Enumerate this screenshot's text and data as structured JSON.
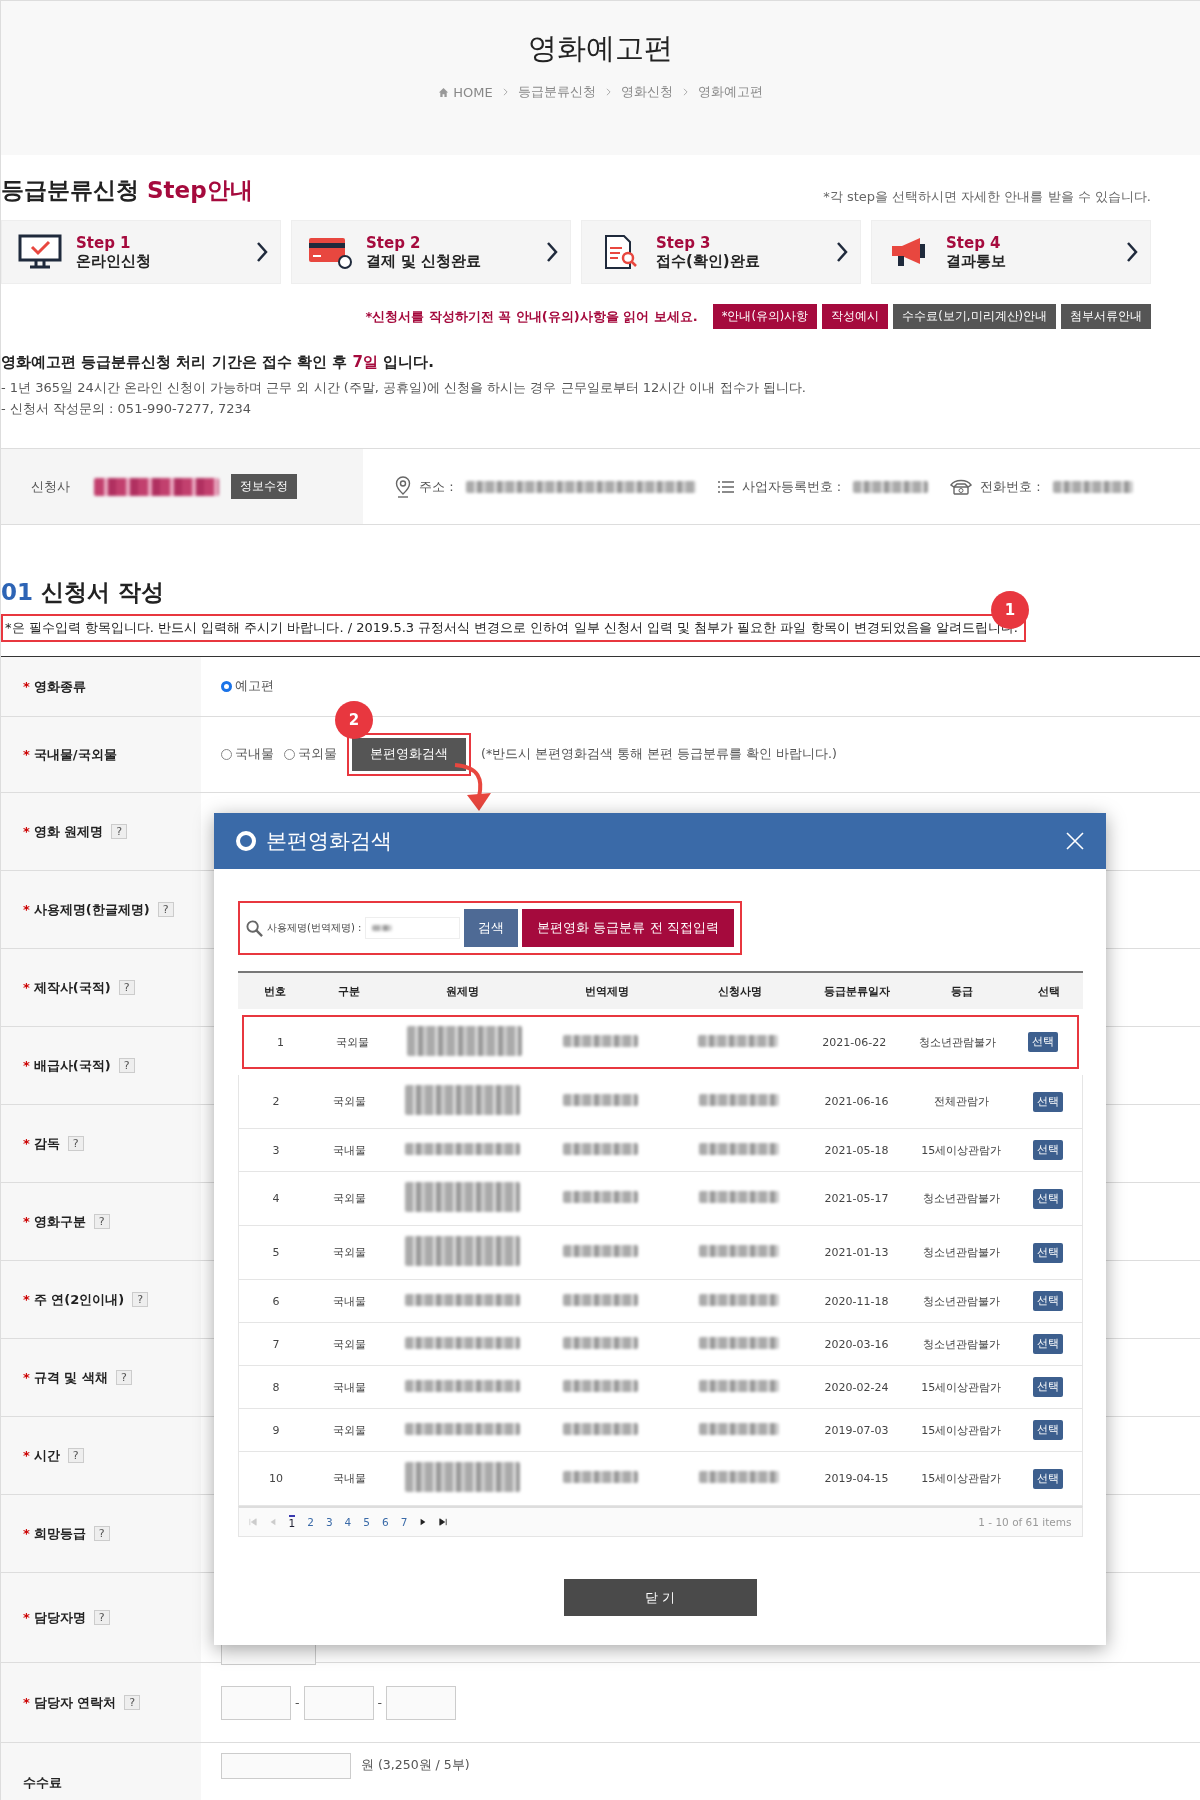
{
  "header": {
    "title": "영화예고편",
    "breadcrumb": [
      "HOME",
      "등급분류신청",
      "영화신청",
      "영화예고편"
    ]
  },
  "steps_section": {
    "title": "등급분류신청",
    "title_accent": "Step안내",
    "hint": "*각 step을 선택하시면 자세한 안내를 받을 수 있습니다.",
    "steps": [
      {
        "kind": "monitor",
        "step": "Step 1",
        "label": "온라인신청"
      },
      {
        "kind": "card",
        "step": "Step 2",
        "label": "결제 및 신청완료"
      },
      {
        "kind": "document",
        "step": "Step 3",
        "label": "접수(확인)완료"
      },
      {
        "kind": "megaphone",
        "step": "Step 4",
        "label": "결과통보"
      }
    ]
  },
  "notice_bar": {
    "text": "*신청서를 작성하기전 꼭 안내(유의)사항을 읽어 보세요.",
    "buttons": [
      {
        "label": "*안내(유의)사항",
        "kind": "primary"
      },
      {
        "label": "작성예시",
        "kind": "primary"
      },
      {
        "label": "수수료(보기,미리계산)안내",
        "kind": "dark"
      },
      {
        "label": "첨부서류안내",
        "kind": "dark"
      }
    ]
  },
  "processing": {
    "headline_before": "영화예고편 등급분류신청 처리 기간은 접수 확인 후 ",
    "headline_highlight": "7일",
    "headline_after": " 입니다.",
    "lines": [
      "- 1년 365일 24시간 온라인 신청이 가능하며 근무 외 시간 (주말, 공휴일)에 신청을 하시는 경우 근무일로부터 12시간 이내 접수가 됩니다.",
      "- 신청서 작성문의 : 051-990-7277, 7234"
    ]
  },
  "applicant": {
    "label": "신청사",
    "edit_button": "정보수정",
    "address_label": "주소 :",
    "business_no_label": "사업자등록번호 :",
    "phone_label": "전화번호 :"
  },
  "form": {
    "number": "01",
    "title": "신청서 작성",
    "notice": "*은 필수입력 항목입니다. 반드시 입력해 주시기 바랍니다. / 2019.5.3 규정서식 변경으로 인하여 일부 신청서 입력 및 첨부가 필요한 파일 항목이 변경되었음을 알려드립니다.",
    "notice_callout": "1",
    "rows": [
      {
        "label": "영화종류",
        "required_mark": "*",
        "kind": "radio",
        "options": [
          {
            "label": "예고편",
            "selected": true
          }
        ]
      },
      {
        "label": "국내물/국외물",
        "required_mark": "*",
        "kind": "radio_search",
        "options": [
          {
            "label": "국내물",
            "selected": false
          },
          {
            "label": "국외물",
            "selected": false
          }
        ],
        "button": "본편영화검색",
        "button_callout": "2",
        "note": "(*반드시 본편영화검색 통해 본편 등급분류를 확인 바랍니다.)"
      },
      {
        "label": "영화 원제명",
        "required_mark": "*",
        "help": "?",
        "kind": "covered"
      },
      {
        "label": "사용제명(한글제명)",
        "required_mark": "*",
        "help": "?",
        "kind": "covered"
      },
      {
        "label": "제작사(국적)",
        "required_mark": "*",
        "help": "?",
        "kind": "covered"
      },
      {
        "label": "배급사(국적)",
        "required_mark": "*",
        "help": "?",
        "kind": "covered"
      },
      {
        "label": "감독",
        "required_mark": "*",
        "help": "?",
        "kind": "covered"
      },
      {
        "label": "영화구분",
        "required_mark": "*",
        "help": "?",
        "kind": "covered"
      },
      {
        "label": "주 연(2인이내)",
        "required_mark": "*",
        "help": "?",
        "kind": "covered"
      },
      {
        "label": "규격 및 색채",
        "required_mark": "*",
        "help": "?",
        "kind": "covered"
      },
      {
        "label": "시간",
        "required_mark": "*",
        "help": "?",
        "kind": "covered"
      },
      {
        "label": "희망등급",
        "required_mark": "*",
        "help": "?",
        "kind": "covered"
      },
      {
        "label": "담당자명",
        "required_mark": "*",
        "help": "?",
        "kind": "text"
      },
      {
        "label": "담당자 연락처",
        "required_mark": "*",
        "help": "?",
        "kind": "phone",
        "separators": [
          "-",
          "-"
        ]
      },
      {
        "label": "수수료",
        "kind": "fee",
        "suffix": "원 (3,250원 / 5부)"
      }
    ]
  },
  "modal": {
    "title": "본편영화검색",
    "search_label": "사용제명(번역제명) :",
    "search_button": "검색",
    "direct_button": "본편영화 등급분류 전 직접입력",
    "columns": [
      "번호",
      "구분",
      "원제명",
      "번역제명",
      "신청사명",
      "등급분류일자",
      "등급",
      "선택"
    ],
    "rows": [
      {
        "no": "1",
        "type": "국외물",
        "date": "2021-06-22",
        "rating": "청소년관람불가",
        "action": "선택",
        "selected": true,
        "tall": true
      },
      {
        "no": "2",
        "type": "국외물",
        "date": "2021-06-16",
        "rating": "전체관람가",
        "action": "선택",
        "selected": false,
        "tall": true
      },
      {
        "no": "3",
        "type": "국내물",
        "date": "2021-05-18",
        "rating": "15세이상관람가",
        "action": "선택",
        "selected": false,
        "tall": false
      },
      {
        "no": "4",
        "type": "국외물",
        "date": "2021-05-17",
        "rating": "청소년관람불가",
        "action": "선택",
        "selected": false,
        "tall": true
      },
      {
        "no": "5",
        "type": "국외물",
        "date": "2021-01-13",
        "rating": "청소년관람불가",
        "action": "선택",
        "selected": false,
        "tall": true
      },
      {
        "no": "6",
        "type": "국내물",
        "date": "2020-11-18",
        "rating": "청소년관람불가",
        "action": "선택",
        "selected": false,
        "tall": false
      },
      {
        "no": "7",
        "type": "국외물",
        "date": "2020-03-16",
        "rating": "청소년관람불가",
        "action": "선택",
        "selected": false,
        "tall": false
      },
      {
        "no": "8",
        "type": "국내물",
        "date": "2020-02-24",
        "rating": "15세이상관람가",
        "action": "선택",
        "selected": false,
        "tall": false
      },
      {
        "no": "9",
        "type": "국외물",
        "date": "2019-07-03",
        "rating": "15세이상관람가",
        "action": "선택",
        "selected": false,
        "tall": false
      },
      {
        "no": "10",
        "type": "국내물",
        "date": "2019-04-15",
        "rating": "15세이상관람가",
        "action": "선택",
        "selected": false,
        "tall": true
      }
    ],
    "pages": [
      {
        "label": "1",
        "selected": true
      },
      {
        "label": "2",
        "selected": false
      },
      {
        "label": "3",
        "selected": false
      },
      {
        "label": "4",
        "selected": false
      },
      {
        "label": "5",
        "selected": false
      },
      {
        "label": "6",
        "selected": false
      },
      {
        "label": "7",
        "selected": false
      }
    ],
    "summary": "1 - 10 of 61 items",
    "close_button": "닫 기"
  }
}
